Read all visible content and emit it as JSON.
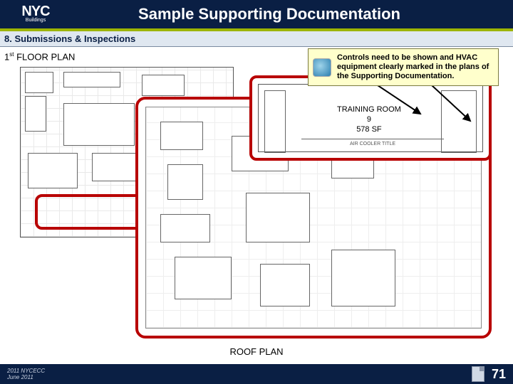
{
  "header": {
    "logo_main": "NYC",
    "logo_sub": "Buildings",
    "title": "Sample Supporting Documentation"
  },
  "section": {
    "label": "8. Submissions & Inspections"
  },
  "labels": {
    "floor_plan_prefix": "1",
    "floor_plan_sup": "st",
    "floor_plan_suffix": " FLOOR PLAN",
    "roof_plan": "ROOF PLAN"
  },
  "callout": {
    "text": "Controls need to be shown and HVAC equipment clearly marked in the plans of the Supporting Documentation."
  },
  "detail": {
    "room_name": "TRAINING ROOM",
    "room_number": "9",
    "room_area": "578 SF",
    "cooler_label": "AIR COOLER TITLE"
  },
  "footer": {
    "line1": "2011 NYCECC",
    "line2": "June 2011",
    "page_number": "71"
  }
}
